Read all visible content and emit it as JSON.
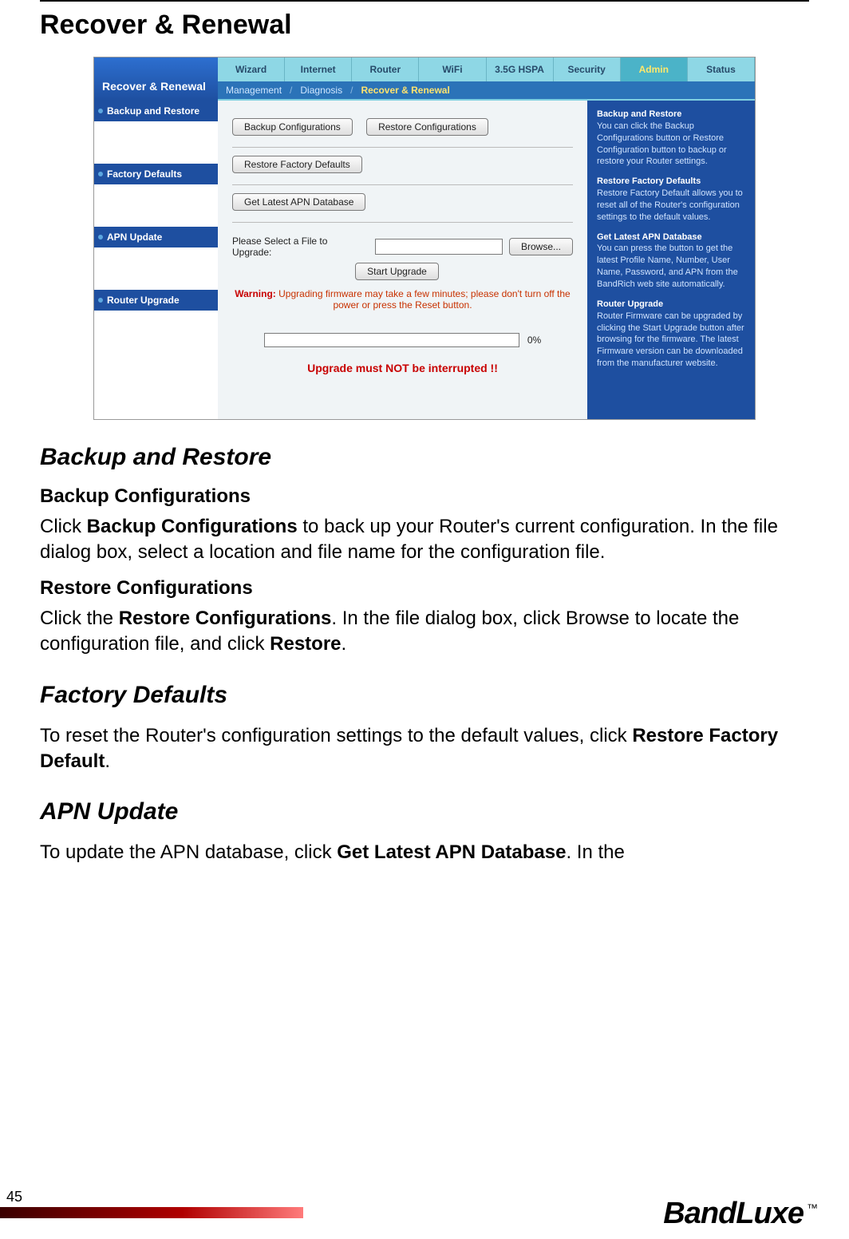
{
  "page": {
    "number": "45",
    "title": "Recover & Renewal",
    "footer_logo": "BandLuxe",
    "footer_tm": "™"
  },
  "shot": {
    "title": "Recover & Renewal",
    "tabs": [
      "Wizard",
      "Internet",
      "Router",
      "WiFi",
      "3.5G HSPA",
      "Security",
      "Admin",
      "Status"
    ],
    "active_tab_index": 6,
    "subtabs": {
      "a": "Management",
      "b": "Diagnosis",
      "c": "Recover & Renewal"
    },
    "nav": [
      "Backup and Restore",
      "Factory Defaults",
      "APN Update",
      "Router Upgrade"
    ],
    "buttons": {
      "backup": "Backup Configurations",
      "restore": "Restore Configurations",
      "factory": "Restore Factory Defaults",
      "apn": "Get Latest APN Database",
      "browse": "Browse...",
      "start": "Start Upgrade"
    },
    "labels": {
      "select_file": "Please Select a File to Upgrade:",
      "progress_pct": "0%"
    },
    "warning_prefix": "Warning:",
    "warning_text": " Upgrading firmware may take a few minutes; please don't turn off the power or press the Reset button.",
    "interrupt": "Upgrade must NOT be interrupted !!",
    "help": {
      "h1": "Backup and Restore",
      "t1": "You can click the Backup Configurations button or Restore Configuration button to backup or restore your Router settings.",
      "h2": "Restore Factory Defaults",
      "t2": "Restore Factory Default allows you to reset all of the Router's configuration settings to the default values.",
      "h3": "Get Latest APN Database",
      "t3": "You can press the button to get the latest Profile Name, Number, User Name, Password, and APN from the BandRich web site automatically.",
      "h4": "Router Upgrade",
      "t4": "Router Firmware can be upgraded by clicking the Start Upgrade button after browsing for the firmware. The latest Firmware version can be downloaded from the manufacturer website."
    }
  },
  "sections": {
    "backup_restore": {
      "title": "Backup and Restore",
      "sub1_title": "Backup Configurations",
      "sub1_p_a": "Click ",
      "sub1_p_b": "Backup Configurations",
      "sub1_p_c": " to back up your Router's current configuration. In the file dialog box, select a location and file name for the configuration file.",
      "sub2_title": "Restore Configurations",
      "sub2_p_a": "Click the ",
      "sub2_p_b": "Restore Configurations",
      "sub2_p_c": ". In the file dialog box, click Browse to locate the configuration file, and click ",
      "sub2_p_d": "Restore",
      "sub2_p_e": "."
    },
    "factory": {
      "title": "Factory Defaults",
      "p_a": "To reset the Router's configuration settings to the default values, click ",
      "p_b": "Restore Factory Default",
      "p_c": "."
    },
    "apn": {
      "title": "APN Update",
      "p_a": "To update the APN database, click ",
      "p_b": "Get Latest APN Database",
      "p_c": ". In the"
    }
  }
}
